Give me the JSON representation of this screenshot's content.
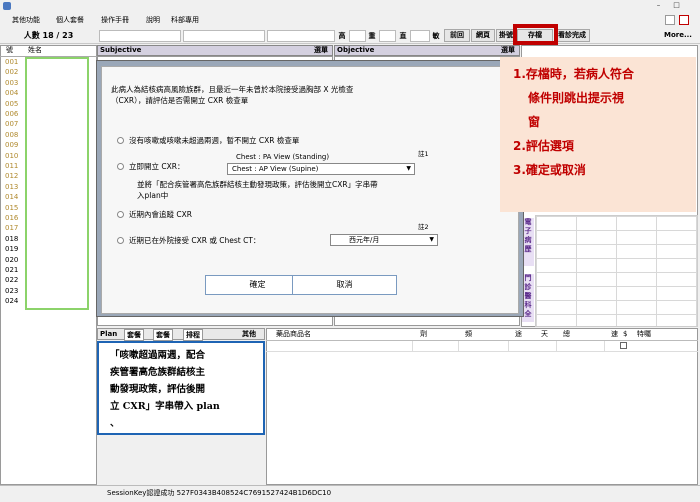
{
  "window": {
    "minimize": "–",
    "maximize": "□"
  },
  "menu": [
    "其他功能",
    "個人套餐",
    "操作手冊",
    "說明",
    "科部專用"
  ],
  "toolbar": {
    "patient_count": "人數 18 / 23",
    "labels": [
      "高",
      "重",
      "直",
      "敏"
    ],
    "buttons": [
      "前回",
      "網頁",
      "掛號",
      "存檔",
      "看診完成"
    ],
    "more": "More..."
  },
  "patient_list": {
    "headers": [
      "號",
      "姓名"
    ],
    "numbers": [
      "001",
      "002",
      "003",
      "004",
      "005",
      "006",
      "007",
      "008",
      "009",
      "010",
      "011",
      "012",
      "013",
      "014",
      "015",
      "016",
      "017",
      "018",
      "019",
      "020",
      "021",
      "022",
      "023",
      "024"
    ]
  },
  "panels": {
    "subjective": "Subjective",
    "subjective_menu": "選單",
    "objective": "Objective",
    "objective_menu": "選單"
  },
  "modal": {
    "intro_line1": "此病人為結核病高風險族群，且最近一年未曾於本院接受過胸部 X 光檢查",
    "intro_line2": "（CXR），請評估是否需開立 CXR 檢查單",
    "option1": "沒有咳嗽或咳嗽未超過兩週，暫不開立 CXR 檢查單",
    "option2_label": "立即開立 CXR：",
    "option2_choice1": "Chest : PA View (Standing)",
    "option2_choice2": "Chest : AP View (Supine)",
    "note1": "註1",
    "option2_desc_line1": "並將「配合疾管署高危族群結核主動發現政策，評估後開立CXR」字串帶",
    "option2_desc_line2": "入plan中",
    "option3": "近期內會追蹤 CXR",
    "option4_label": "近期已在外院接受 CXR 或 Chest CT：",
    "option4_select": "西元年/月",
    "note2": "註2",
    "confirm": "確定",
    "cancel": "取消"
  },
  "annotation": {
    "line1": "1.存檔時，若病人符合",
    "line2": "條件則跳出提示視",
    "line3": "窗",
    "line4": "2.評估選項",
    "line5": "3.確定或取消"
  },
  "side_labels": {
    "record": "電子病歷",
    "clinic": "門診醫科全"
  },
  "plan": {
    "label": "Plan",
    "tabs": [
      "套餐",
      "套餐",
      "排程"
    ],
    "other": "其他",
    "note_lines": [
      "「咳嗽超過兩週，配合",
      "疾管署高危族群結核主",
      "動發現政策，評估後開",
      "立 CXR」字串帶入 plan"
    ]
  },
  "order_table": {
    "headers": [
      "藥品商品名",
      "劑",
      "頻",
      "途",
      "天",
      "總",
      "速",
      "$",
      "特囑"
    ]
  },
  "status": {
    "session": "SessionKey認證成功 527F0343B408524C7691527424B1D6DC10"
  },
  "colors": {
    "annotation_red": "#c00000",
    "annotation_bg": "#fbe4d5",
    "plan_border": "#1e64b4",
    "list_green": "#8cd36a"
  }
}
